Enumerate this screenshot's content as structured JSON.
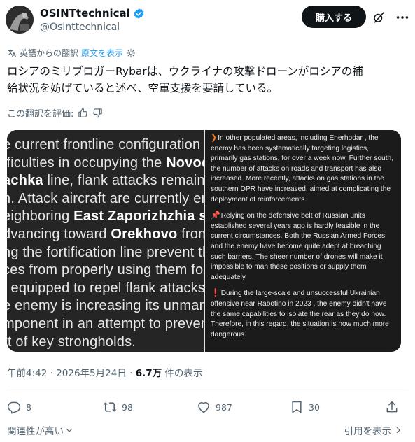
{
  "author": {
    "display_name": "OSINTtechnical",
    "handle": "@Osinttechnical"
  },
  "header": {
    "buy_label": "購入する"
  },
  "translation": {
    "label": "英語からの翻訳",
    "show_original": "原文を表示"
  },
  "tweet": {
    "text_line1": "ロシアのミリブロガーRybarは、ウクライナの攻撃ドローンがロシアの補",
    "text_line2": "給状況を妨げていると述べ、空軍支援を要請している。"
  },
  "rating": {
    "label": "この翻訳を評価:"
  },
  "media": {
    "left_lines": [
      {
        "pre": "e current frontline configuration an",
        "bold": "",
        "post": ""
      },
      {
        "pre": "fficulties in occupying the ",
        "bold": "Novoda",
        "post": ""
      },
      {
        "pre": "",
        "bold": "achka",
        "post": " line, flank attacks remain th"
      },
      {
        "pre": "n. Attack aircraft are currently eng",
        "bold": "",
        "post": ""
      },
      {
        "pre": "eighboring ",
        "bold": "East Zaporizhzhia sect",
        "post": ""
      },
      {
        "pre": "dvancing toward ",
        "bold": "Orekhovo",
        "post": " from th"
      },
      {
        "pre": "ng the fortification line prevent the",
        "bold": "",
        "post": ""
      },
      {
        "pre": "ces from properly using them for d",
        "bold": "",
        "post": ""
      },
      {
        "pre": "t equipped to repel flank attacks. G",
        "bold": "",
        "post": ""
      },
      {
        "pre": "e enemy is increasing its unmann",
        "bold": "",
        "post": ""
      },
      {
        "pre": "mponent in an attempt to prevent th",
        "bold": "",
        "post": ""
      },
      {
        "pre": "rt of key strongholds.",
        "bold": "",
        "post": ""
      }
    ],
    "right_p1_emoji": "❯",
    "right_p1": "In other populated areas, including Enerhodar , the enemy has been systematically targeting logistics, primarily gas stations, for over a week now. Further south, the number of attacks on roads and transport has also increased. More recently, attacks on gas stations in the southern DPR have increased, aimed at complicating the deployment of reinforcements.",
    "right_p2_emoji": "📌",
    "right_p2": "Relying on the defensive belt of Russian units established several years ago is hardly feasible in the current circumstances. Both the Russian Armed Forces and the enemy have become quite adept at breaching such barriers. The sheer number of drones will make it impossible to man these positions or supply them adequately.",
    "right_p3_emoji": "❗",
    "right_p3": "During the large-scale and unsuccessful Ukrainian offensive near Rabotino in 2023 , the enemy didn't have the same capabilities to isolate the rear as they do now. Therefore, in this regard, the situation is now much more dangerous."
  },
  "meta": {
    "time_date": "午前4:42 · 2026年5月24日 · ",
    "views": "6.7万",
    "views_suffix": " 件の表示"
  },
  "actions": {
    "replies": "8",
    "reposts": "98",
    "likes": "987",
    "bookmarks": "30"
  },
  "footer": {
    "relevance": "関連性が高い",
    "quotes": "引用を表示"
  },
  "colors": {
    "accent": "#1d9bf0",
    "text": "#0f1419",
    "muted": "#536471",
    "verified": "#1d9bf0"
  }
}
